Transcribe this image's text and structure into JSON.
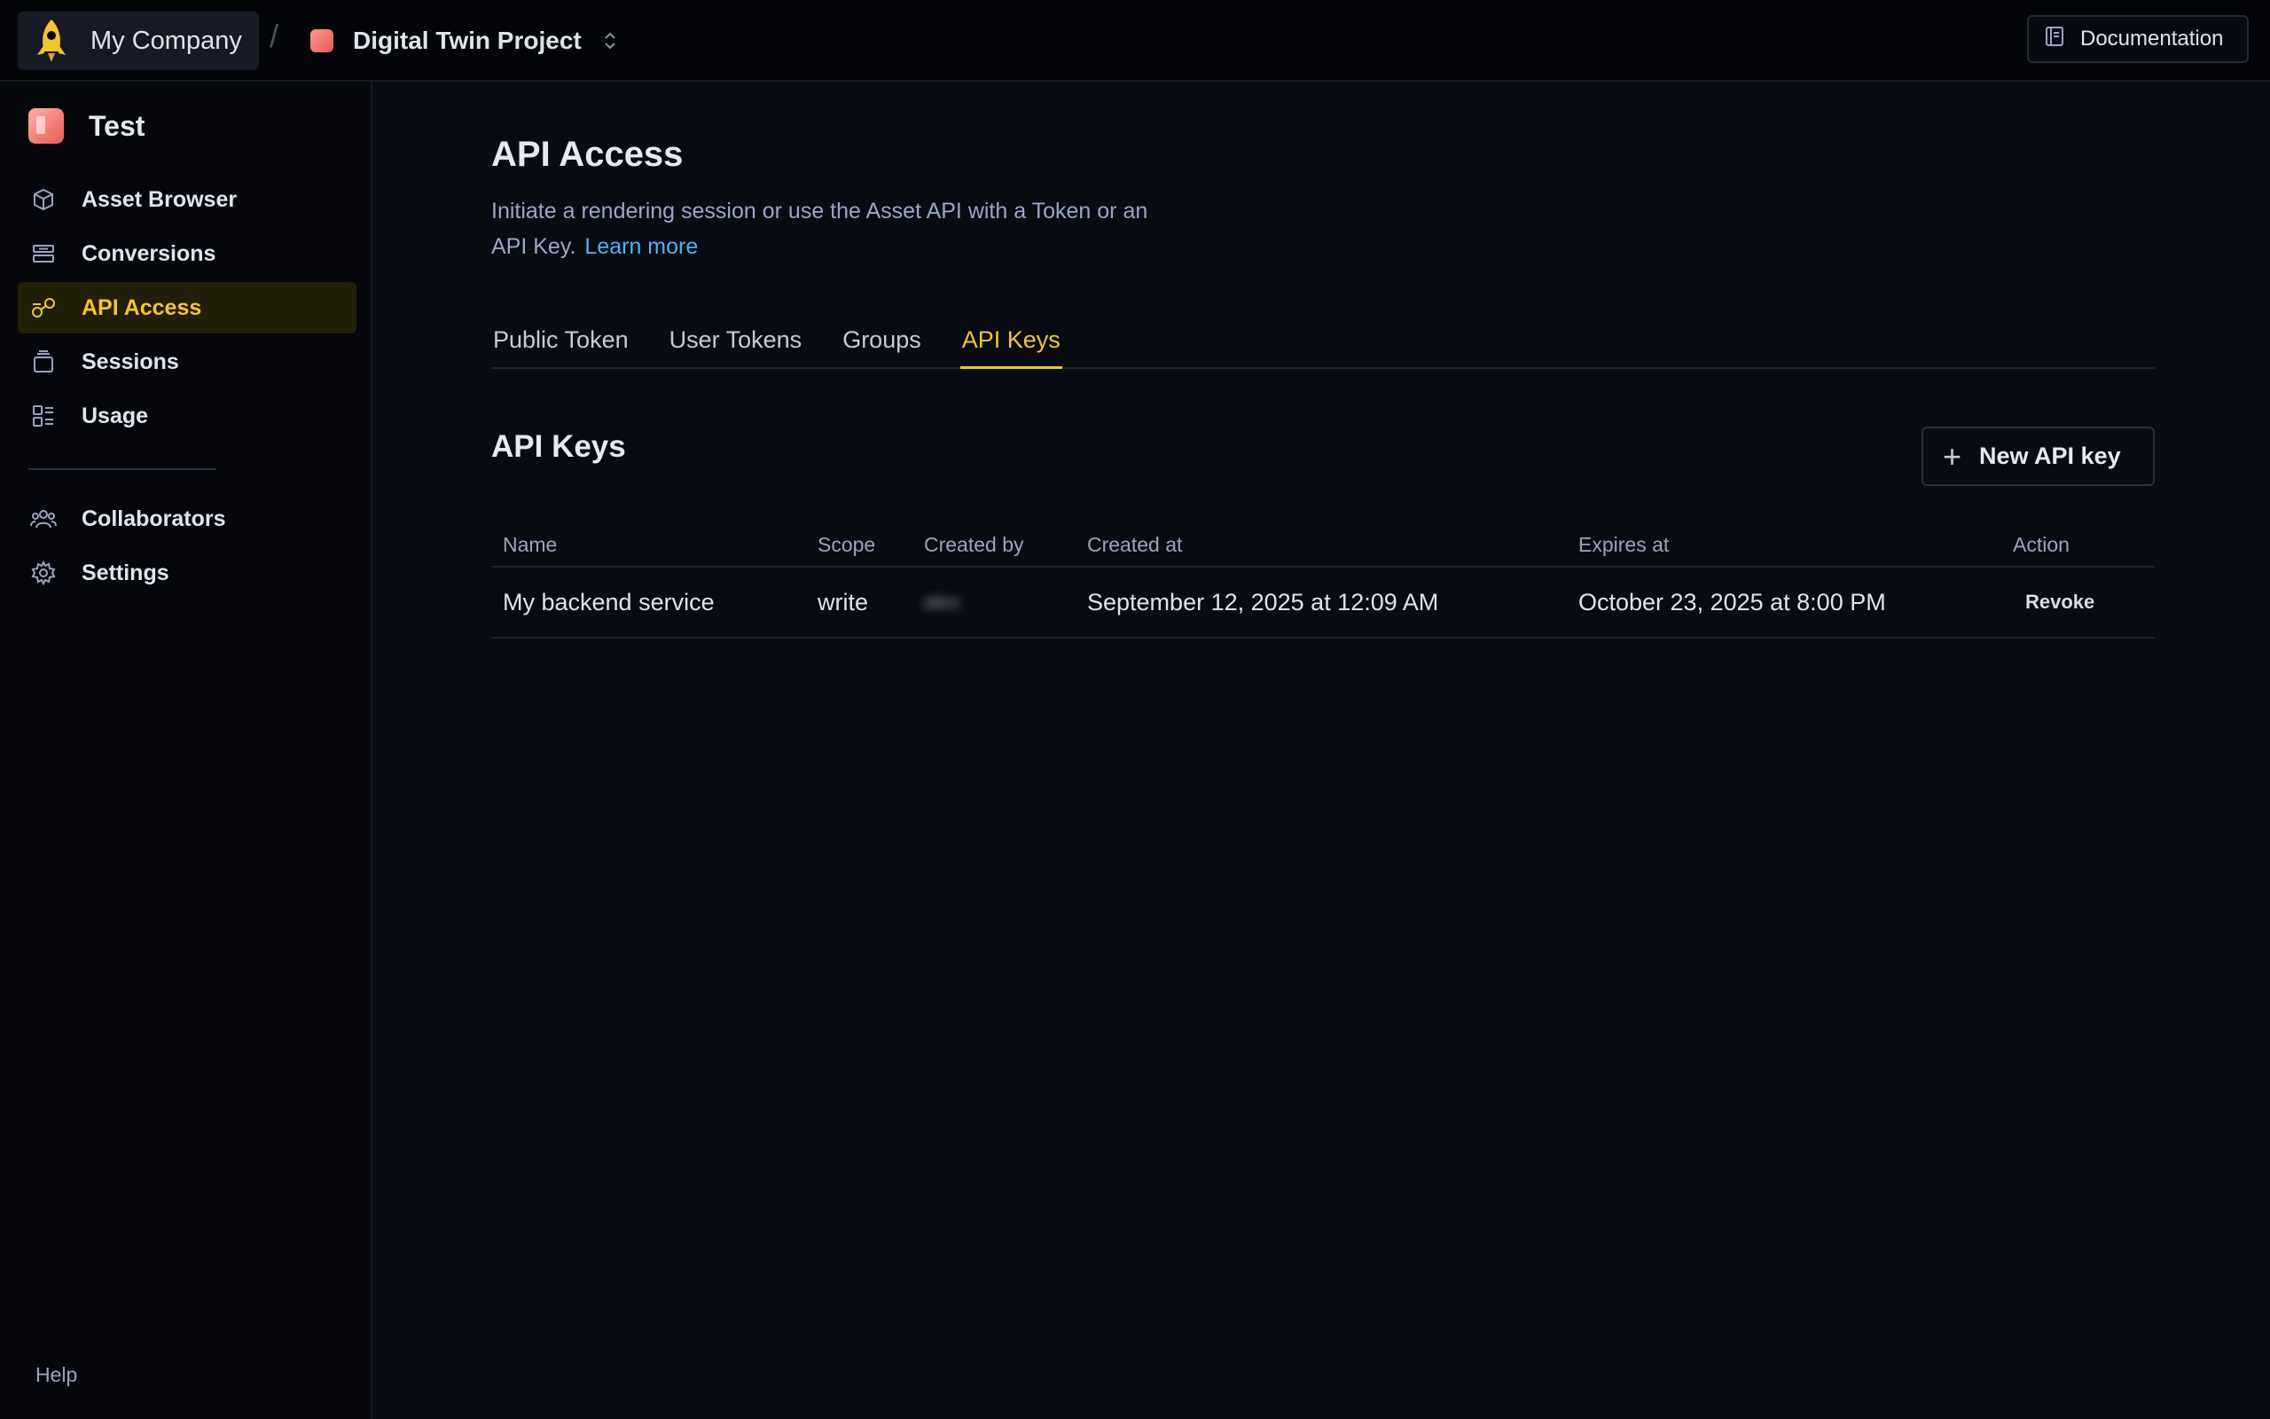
{
  "topbar": {
    "org_name": "My Company",
    "separator": "/",
    "project_name": "Digital Twin Project",
    "doc_label": "Documentation"
  },
  "sidebar": {
    "env_name": "Test",
    "items": [
      {
        "label": "Asset Browser",
        "icon": "cube-icon"
      },
      {
        "label": "Conversions",
        "icon": "conversions-icon"
      },
      {
        "label": "API Access",
        "icon": "key-icon",
        "active": true
      },
      {
        "label": "Sessions",
        "icon": "sessions-icon"
      },
      {
        "label": "Usage",
        "icon": "grid-icon"
      }
    ],
    "items2": [
      {
        "label": "Collaborators",
        "icon": "users-icon"
      },
      {
        "label": "Settings",
        "icon": "gear-icon"
      }
    ],
    "help": "Help"
  },
  "main": {
    "title": "API Access",
    "description": "Initiate a rendering session or use the Asset API with a Token or an API Key.",
    "learn_more": "Learn more",
    "tabs": [
      "Public Token",
      "User Tokens",
      "Groups",
      "API Keys"
    ],
    "active_tab": "API Keys",
    "section_title": "API Keys",
    "new_key_label": "New API key",
    "table": {
      "headers": [
        "Name",
        "Scope",
        "Created by",
        "Created at",
        "Expires at",
        "Action"
      ],
      "rows": [
        {
          "name": "My backend service",
          "scope": "write",
          "created_by": "alex",
          "created_at": "September 12, 2025 at 12:09 AM",
          "expires_at": "October 23, 2025 at 8:00 PM",
          "action": "Revoke"
        }
      ]
    }
  },
  "colors": {
    "accent": "#f2c531",
    "link": "#4db3f5",
    "background": "#080b12"
  }
}
